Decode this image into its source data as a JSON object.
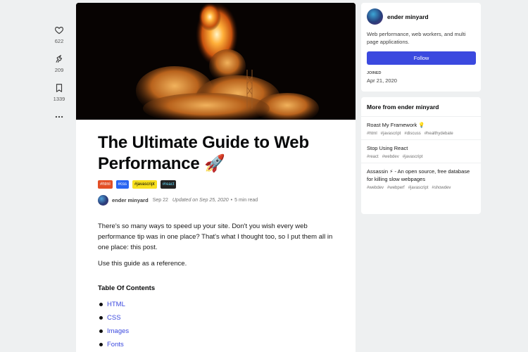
{
  "reactions": [
    {
      "icon": "heart-icon",
      "count": "622"
    },
    {
      "icon": "unicorn-icon",
      "count": "209"
    },
    {
      "icon": "bookmark-icon",
      "count": "1339"
    }
  ],
  "article": {
    "title": "The Ultimate Guide to Web Performance 🚀",
    "tags": [
      {
        "label": "#html",
        "bg": "#e34f26",
        "fg": "#ffffff"
      },
      {
        "label": "#css",
        "bg": "#2965f1",
        "fg": "#ffffff"
      },
      {
        "label": "#javascript",
        "bg": "#f7df1e",
        "fg": "#000000"
      },
      {
        "label": "#react",
        "bg": "#222222",
        "fg": "#61dafb"
      }
    ],
    "author": "ender minyard",
    "date": "Sep 22",
    "updated": "Updated on Sep 25, 2020",
    "read_time": "5 min read",
    "paragraphs": [
      "There's so many ways to speed up your site. Don't you wish every web performance tip was in one place? That's what I thought too, so I put them all in one place: this post.",
      "Use this guide as a reference."
    ],
    "toc_heading": "Table Of Contents",
    "toc": [
      "HTML",
      "CSS",
      "Images",
      "Fonts"
    ]
  },
  "profile": {
    "name": "ender minyard",
    "bio": "Web performance, web workers, and multi page applications.",
    "follow_label": "Follow",
    "joined_label": "JOINED",
    "joined_date": "Apr 21, 2020"
  },
  "more": {
    "heading": "More from ender minyard",
    "posts": [
      {
        "title": "Roast My Framework 💡",
        "tags": [
          "#html",
          "#javascript",
          "#discuss",
          "#healthydebate"
        ]
      },
      {
        "title": "Stop Using React",
        "tags": [
          "#react",
          "#webdev",
          "#javascript"
        ]
      },
      {
        "title": "Assassin ⚡ - An open source, free database for killing slow webpages",
        "tags": [
          "#webdev",
          "#webperf",
          "#javascript",
          "#showdev"
        ]
      }
    ]
  },
  "colors": {
    "accent": "#3b49df",
    "page_bg": "#eef0f1"
  }
}
